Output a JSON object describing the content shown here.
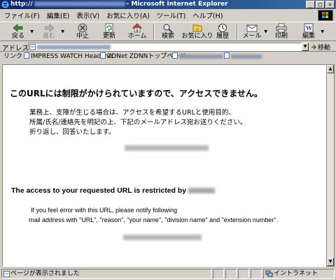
{
  "window": {
    "title_prefix": "http://",
    "title_suffix": "- Microsoft Internet Explorer",
    "controls": [
      "_",
      "□",
      "×"
    ]
  },
  "menu": [
    "ファイル(F)",
    "編集(E)",
    "表示(V)",
    "お気に入り(A)",
    "ツール(T)",
    "ヘルプ(H)"
  ],
  "toolbar": {
    "back": "戻る",
    "forward": "進む",
    "stop": "中止",
    "refresh": "更新",
    "home": "ホーム",
    "search": "検索",
    "favorites": "お気に入り",
    "history": "履歴",
    "mail": "メール",
    "print": "印刷",
    "edit": "編集"
  },
  "address": {
    "label": "アドレス(D)",
    "go": "移動"
  },
  "links": {
    "label": "リンク",
    "items": [
      "IMPRESS WATCH Headline",
      "ZDNet ZDNNトップページ"
    ]
  },
  "page": {
    "heading_jp": "このURLには制限がかけられていますので、アクセスできません。",
    "jp_lines": [
      "業務上、支障が生じる場合は、アクセスを希望するURLと使用目的、",
      "所属/氏名/連絡先を明記の上、下記のメールアドレス宛お送りください。",
      "折り返し、回答いたします。"
    ],
    "heading_en": "The access to your requested URL is restricted by",
    "en_lines": [
      "If you feel error with this URL, please notify following",
      "mail address with \"URL\", \"reason\", \"your name\", \"division name\" and \"extension number\"."
    ]
  },
  "status": {
    "text": "ページが表示されました",
    "zone": "イントラネット"
  }
}
